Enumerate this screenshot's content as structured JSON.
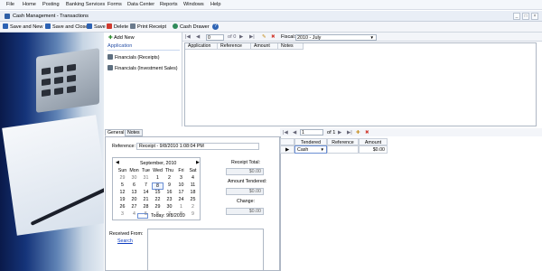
{
  "menu": [
    "File",
    "Home",
    "Posting",
    "Banking Services",
    "Forms",
    "Data Center",
    "Reports",
    "Windows",
    "Help"
  ],
  "window": {
    "title": "Cash Management - Transactions",
    "min": "_",
    "max": "□",
    "close": "×"
  },
  "toolbar": {
    "save_new": "Save and New",
    "save_close": "Save and Close",
    "save": "Save",
    "delete": "Delete",
    "print_receipt": "Print Receipt",
    "cash_drawer": "Cash Drawer",
    "help": "?"
  },
  "app_pane": {
    "add_new": "Add New",
    "header": "Application",
    "items": [
      "Financials (Receipts)",
      "Financials (Investment Sales)"
    ]
  },
  "top_nav": {
    "first": "|◀",
    "prev": "◀",
    "page_value": "0",
    "of": "of 0",
    "next": "▶",
    "last": "▶|",
    "fiscal_label": "Fiscal:",
    "fiscal_value": "2010 - July",
    "dropdown": "▼"
  },
  "top_grid": {
    "columns": [
      "Application",
      "Reference",
      "Amount",
      "Notes"
    ]
  },
  "tabs": [
    "General",
    "Notes"
  ],
  "general": {
    "reference_label": "Reference:",
    "reference_value": "Receipt - 9/8/2010 1:08:04 PM",
    "receipt_total_label": "Receipt Total:",
    "receipt_total_value": "$0.00",
    "amount_tendered_label": "Amount Tendered:",
    "amount_tendered_value": "$0.00",
    "change_label": "Change:",
    "change_value": "$0.00",
    "received_from_label": "Received From:",
    "search_link": "Search"
  },
  "calendar": {
    "prev": "◀",
    "next": "▶",
    "month": "September, 2010",
    "dow": [
      "Sun",
      "Mon",
      "Tue",
      "Wed",
      "Thu",
      "Fri",
      "Sat"
    ],
    "weeks": [
      [
        "29",
        "30",
        "31",
        "1",
        "2",
        "3",
        "4"
      ],
      [
        "5",
        "6",
        "7",
        "8",
        "9",
        "10",
        "11"
      ],
      [
        "12",
        "13",
        "14",
        "15",
        "16",
        "17",
        "18"
      ],
      [
        "19",
        "20",
        "21",
        "22",
        "23",
        "24",
        "25"
      ],
      [
        "26",
        "27",
        "28",
        "29",
        "30",
        "1",
        "2"
      ],
      [
        "3",
        "4",
        "5",
        "6",
        "7",
        "8",
        "9"
      ]
    ],
    "today_label": "Today: 9/8/2010",
    "selected": "8"
  },
  "right_nav": {
    "first": "|◀",
    "prev": "◀",
    "page_value": "1",
    "of": "of 1",
    "next": "▶",
    "last": "▶|"
  },
  "right_grid": {
    "columns": [
      "Tendered",
      "Reference",
      "Amount"
    ],
    "rows": [
      {
        "tendered": "Cash",
        "reference": "",
        "amount": "$0.00"
      }
    ],
    "dropdown": "▼"
  }
}
